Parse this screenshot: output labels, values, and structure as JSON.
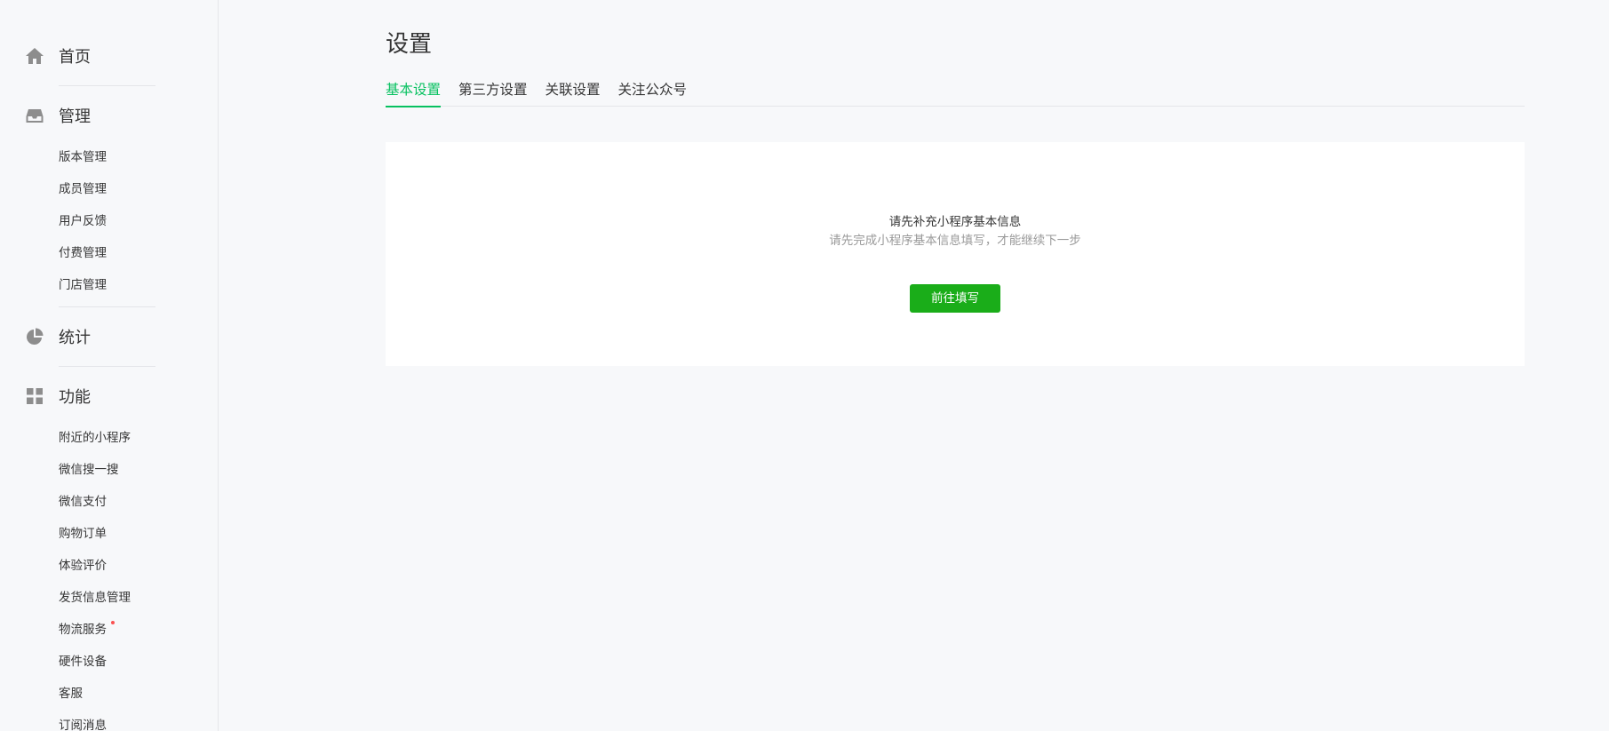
{
  "sidebar": {
    "home": {
      "label": "首页",
      "icon": "home-icon"
    },
    "manage": {
      "label": "管理",
      "icon": "inbox-icon",
      "items": [
        "版本管理",
        "成员管理",
        "用户反馈",
        "付费管理",
        "门店管理"
      ]
    },
    "stats": {
      "label": "统计",
      "icon": "pie-chart-icon"
    },
    "features": {
      "label": "功能",
      "icon": "grid-icon",
      "items": [
        "附近的小程序",
        "微信搜一搜",
        "微信支付",
        "购物订单",
        "体验评价",
        "发货信息管理",
        "物流服务",
        "硬件设备",
        "客服",
        "订阅消息"
      ],
      "badge_item_index": 6
    }
  },
  "main": {
    "title": "设置",
    "tabs": [
      "基本设置",
      "第三方设置",
      "关联设置",
      "关注公众号"
    ],
    "active_tab_index": 0,
    "card": {
      "title": "请先补充小程序基本信息",
      "description": "请先完成小程序基本信息填写，才能继续下一步",
      "button_label": "前往填写"
    }
  },
  "colors": {
    "accent": "#07c160",
    "button": "#1aad19",
    "badge": "#fa5151",
    "muted_text": "#9a9a9a",
    "icon": "#8d8d8d"
  }
}
